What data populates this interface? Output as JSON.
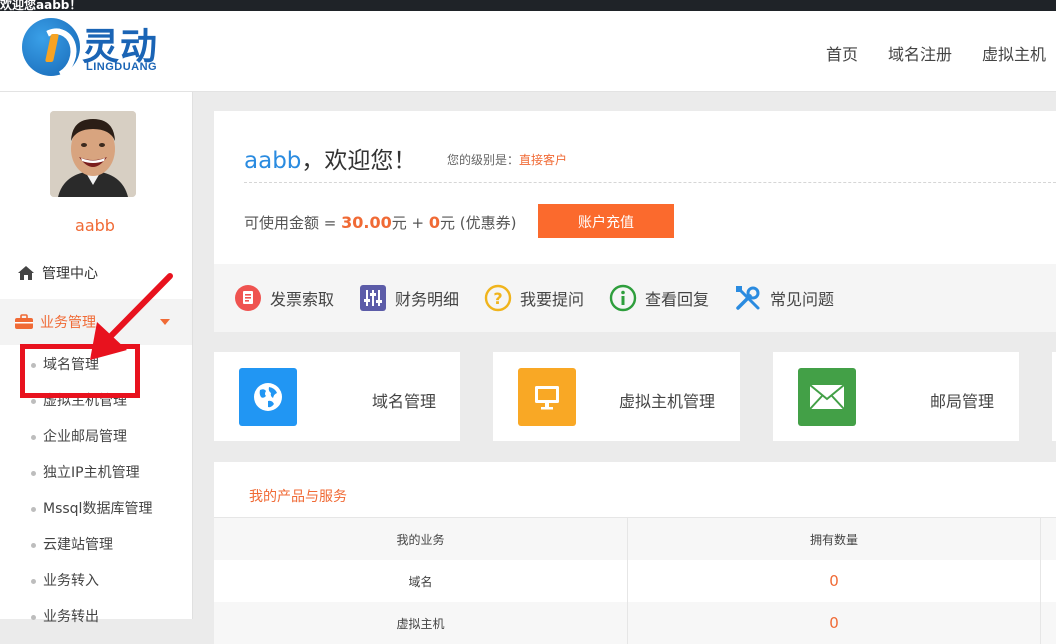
{
  "topbar": {
    "text": "欢迎您aabb！"
  },
  "header": {
    "logo_cn": "灵动",
    "logo_en": "LINGDUANG",
    "nav": [
      "首页",
      "域名注册",
      "虚拟主机"
    ]
  },
  "sidebar": {
    "username": "aabb",
    "home_label": "管理中心",
    "biz_label": "业务管理",
    "sub_items": [
      "域名管理",
      "虚拟主机管理",
      "企业邮局管理",
      "独立IP主机管理",
      "Mssql数据库管理",
      "云建站管理",
      "业务转入",
      "业务转出"
    ]
  },
  "welcome": {
    "name": "aabb",
    "greeting": "，欢迎您！",
    "level_label": "您的级别是：",
    "level_value": "直接客户",
    "balance_label": "可使用金额 = ",
    "balance_amount": "30.00",
    "balance_unit": "元 + ",
    "coupon_amount": "0",
    "coupon_unit": "元 (优惠券)",
    "recharge_label": "账户充值"
  },
  "quick_links": [
    "发票索取",
    "财务明细",
    "我要提问",
    "查看回复",
    "常见问题"
  ],
  "cards": [
    {
      "label": "域名管理",
      "icon": "globe-icon",
      "color": "#2196f3"
    },
    {
      "label": "虚拟主机管理",
      "icon": "monitor-icon",
      "color": "#f9a825"
    },
    {
      "label": "邮局管理",
      "icon": "envelope-icon",
      "color": "#43a047"
    }
  ],
  "products": {
    "tab_label": "我的产品与服务",
    "columns": [
      "我的业务",
      "拥有数量"
    ],
    "rows": [
      {
        "name": "域名",
        "count": "0"
      },
      {
        "name": "虚拟主机",
        "count": "0"
      }
    ]
  },
  "colors": {
    "accent": "#f06a35",
    "brand": "#1a64b5",
    "highlight": "#e8121e"
  }
}
